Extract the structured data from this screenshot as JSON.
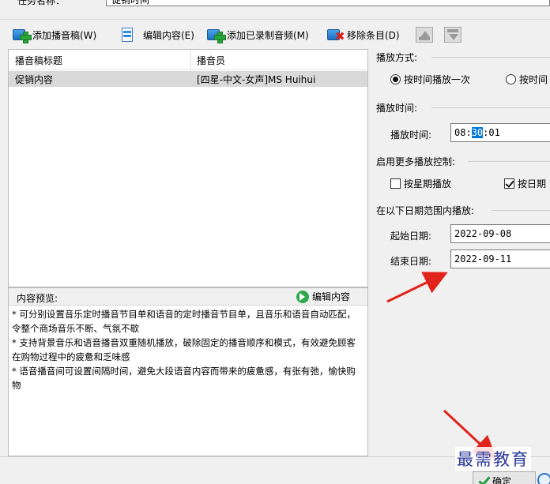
{
  "top": {
    "label": "任务名称：",
    "value": "促销时间"
  },
  "toolbar": {
    "add_script": "添加播音稿(W)",
    "edit_content": "编辑内容(E)",
    "add_recorded": "添加已录制音频(M)",
    "remove_item": "移除条目(D)"
  },
  "list": {
    "columns": [
      "播音稿标题",
      "播音员"
    ],
    "rows": [
      {
        "title": "促销内容",
        "announcer": "[四星-中文-女声]MS Huihui"
      }
    ]
  },
  "preview": {
    "title": "内容预览:",
    "edit_button": "编辑内容",
    "lines": [
      "* 可分别设置音乐定时播音节目单和语音的定时播音节目单，且音乐和语音自动匹配，令整个商场音乐不断、气氛不歇",
      "* 支持背景音乐和语音播音双重随机播放，破除固定的播音顺序和模式，有效避免顾客在购物过程中的疲惫和乏味感",
      "* 语音播音间可设置间隔时间，避免大段语音内容而带来的疲惫感，有张有弛，愉快购物"
    ]
  },
  "right": {
    "play_mode_title": "播放方式:",
    "play_mode_options": [
      "按时间播放一次",
      "按时间"
    ],
    "play_mode_selected": 0,
    "play_time_title": "播放时间:",
    "play_time_label": "播放时间:",
    "play_time_hh": "08",
    "play_time_mm": "30",
    "play_time_ss": "01",
    "more_control_title": "启用更多播放控制:",
    "by_week_label": "按星期播放",
    "by_week_checked": false,
    "by_date_label": "按日期",
    "by_date_checked": true,
    "date_range_title": "在以下日期范围内播放:",
    "start_label": "起始日期:",
    "start_value": "2022-09-08",
    "end_label": "结束日期:",
    "end_value": "2022-09-11"
  },
  "bottom": {
    "ok_label": "确定"
  },
  "watermark": "最需教育",
  "colors": {
    "arrow": "#e0241b",
    "selection": "#0078d7",
    "row_highlight": "#d9d9d9"
  }
}
